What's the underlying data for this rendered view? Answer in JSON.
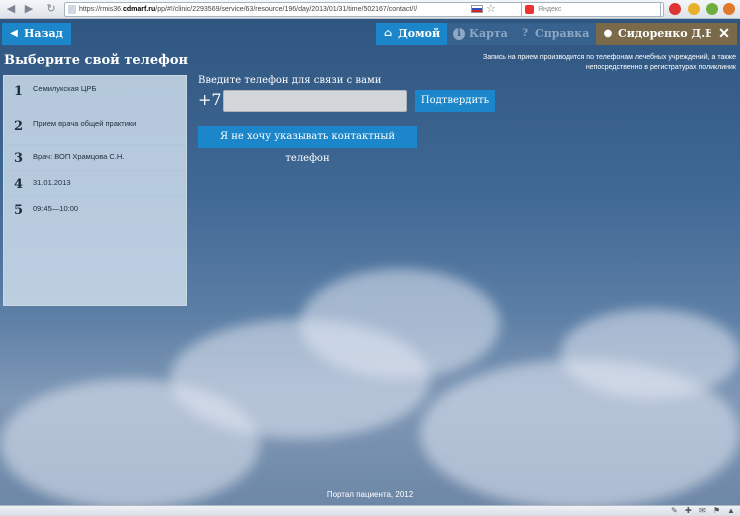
{
  "browser": {
    "url_prefix": "https://rmis36.",
    "url_domain": "cdmarf.ru",
    "url_path": "/pp/#!/clinic/2293569/service/63/resource/196/day/2013/01/31/time/502167/contact/!/",
    "search_placeholder": "Яндекс"
  },
  "header": {
    "back_label": "Назад",
    "home_label": "Домой",
    "map_label": "Карта",
    "help_label": "Справка",
    "user_label": "Сидоренко Д.Е.",
    "close_label": "✕"
  },
  "page": {
    "title": "Выберите свой телефон",
    "notice": "Запись на прием производится по телефонам лечебных учреждений, а также непосредственно в регистратурах поликлиник"
  },
  "steps": [
    {
      "num": "1",
      "label": "Семилукская ЦРБ"
    },
    {
      "num": "2",
      "label": "Прием врача общей практики"
    },
    {
      "num": "3",
      "label": "Врач: ВОП Храмцова С.Н."
    },
    {
      "num": "4",
      "label": "31.01.2013"
    },
    {
      "num": "5",
      "label": "09:45—10:00"
    }
  ],
  "phone": {
    "prompt": "Введите телефон для связи с вами",
    "prefix": "+7",
    "value": "",
    "confirm_label": "Подтвердить",
    "skip_label": "Я не хочу указывать контактный телефон"
  },
  "footer": {
    "text": "Портал пациента, 2012"
  }
}
